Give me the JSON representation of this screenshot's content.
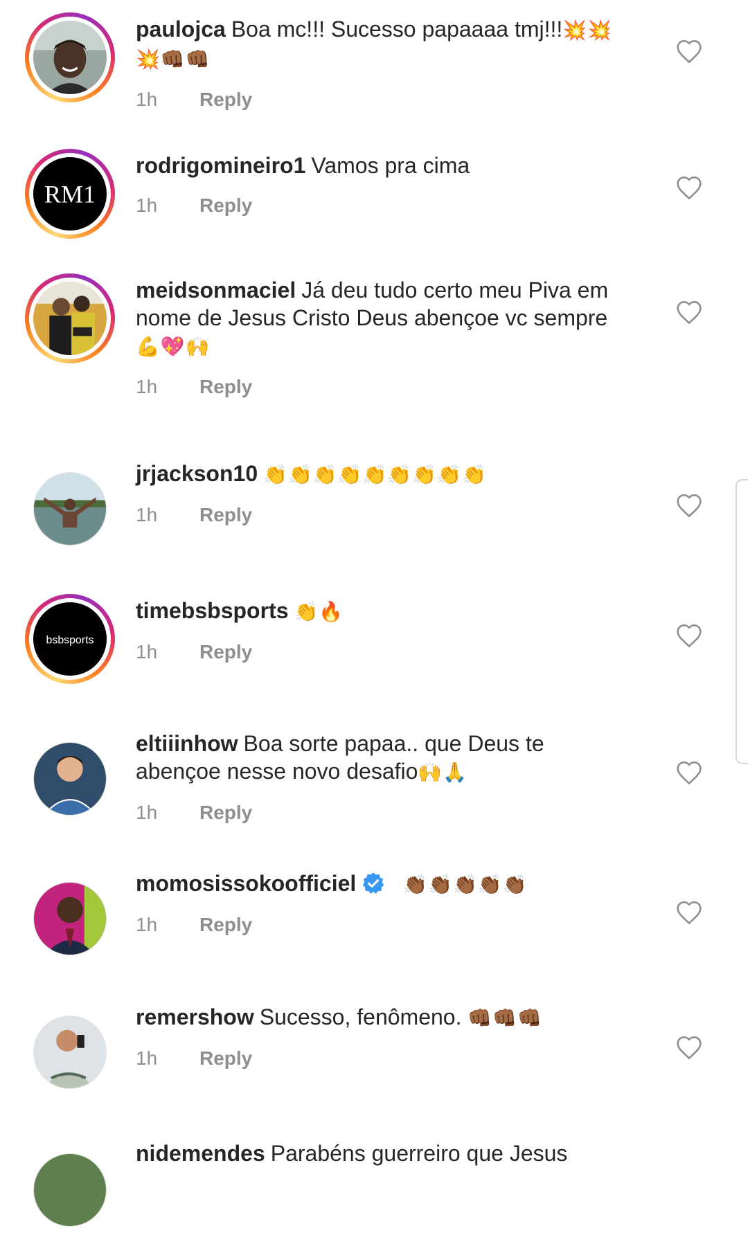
{
  "comments": [
    {
      "username": "paulojca",
      "text": "Boa mc!!! Sucesso papaaaa tmj!!!",
      "emojis": "💥💥💥👊🏾👊🏾",
      "time": "1h",
      "reply": "Reply",
      "story": true,
      "avatar": "photo-man-smiling"
    },
    {
      "username": "rodrigomineiro1",
      "text": "Vamos pra cima",
      "emojis": "",
      "time": "1h",
      "reply": "Reply",
      "story": true,
      "avatar": "logo",
      "avatar_text": "RM1"
    },
    {
      "username": "meidsonmaciel",
      "text": "Já deu tudo certo meu Piva em nome de Jesus Cristo Deus abençoe vc sempre",
      "emojis": "💪💖🙌",
      "time": "1h",
      "reply": "Reply",
      "story": true,
      "avatar": "photo-two-men"
    },
    {
      "username": "jrjackson10",
      "text": "",
      "emojis": "👏👏👏👏👏👏👏👏👏",
      "time": "1h",
      "reply": "Reply",
      "story": false,
      "avatar": "photo-beach"
    },
    {
      "username": "timebsbsports",
      "text": "",
      "emojis": "👏🔥",
      "time": "1h",
      "reply": "Reply",
      "story": true,
      "avatar": "logo",
      "avatar_text": "bsbsports"
    },
    {
      "username": "eltiiinhow",
      "text": "Boa sorte papaa.. que Deus te abençoe nesse novo desafio",
      "emojis": "🙌🙏",
      "time": "1h",
      "reply": "Reply",
      "story": false,
      "avatar": "photo-man-blue"
    },
    {
      "username": "momosissokoofficiel",
      "text": "",
      "emojis": "👏🏾👏🏾👏🏾👏🏾👏🏾",
      "time": "1h",
      "reply": "Reply",
      "story": false,
      "verified": true,
      "avatar": "photo-man-suit"
    },
    {
      "username": "remershow",
      "text": "Sucesso, fenômeno.",
      "emojis": "👊🏾👊🏾👊🏾",
      "time": "1h",
      "reply": "Reply",
      "story": false,
      "avatar": "photo-man-selfie"
    },
    {
      "username": "nidemendes",
      "text": "Parabéns guerreiro que Jesus",
      "emojis": "",
      "time": "",
      "reply": "",
      "story": false,
      "avatar": "photo-partial"
    }
  ],
  "colors": {
    "text": "#262626",
    "muted": "#8e8e8e",
    "verified": "#3897f0"
  }
}
